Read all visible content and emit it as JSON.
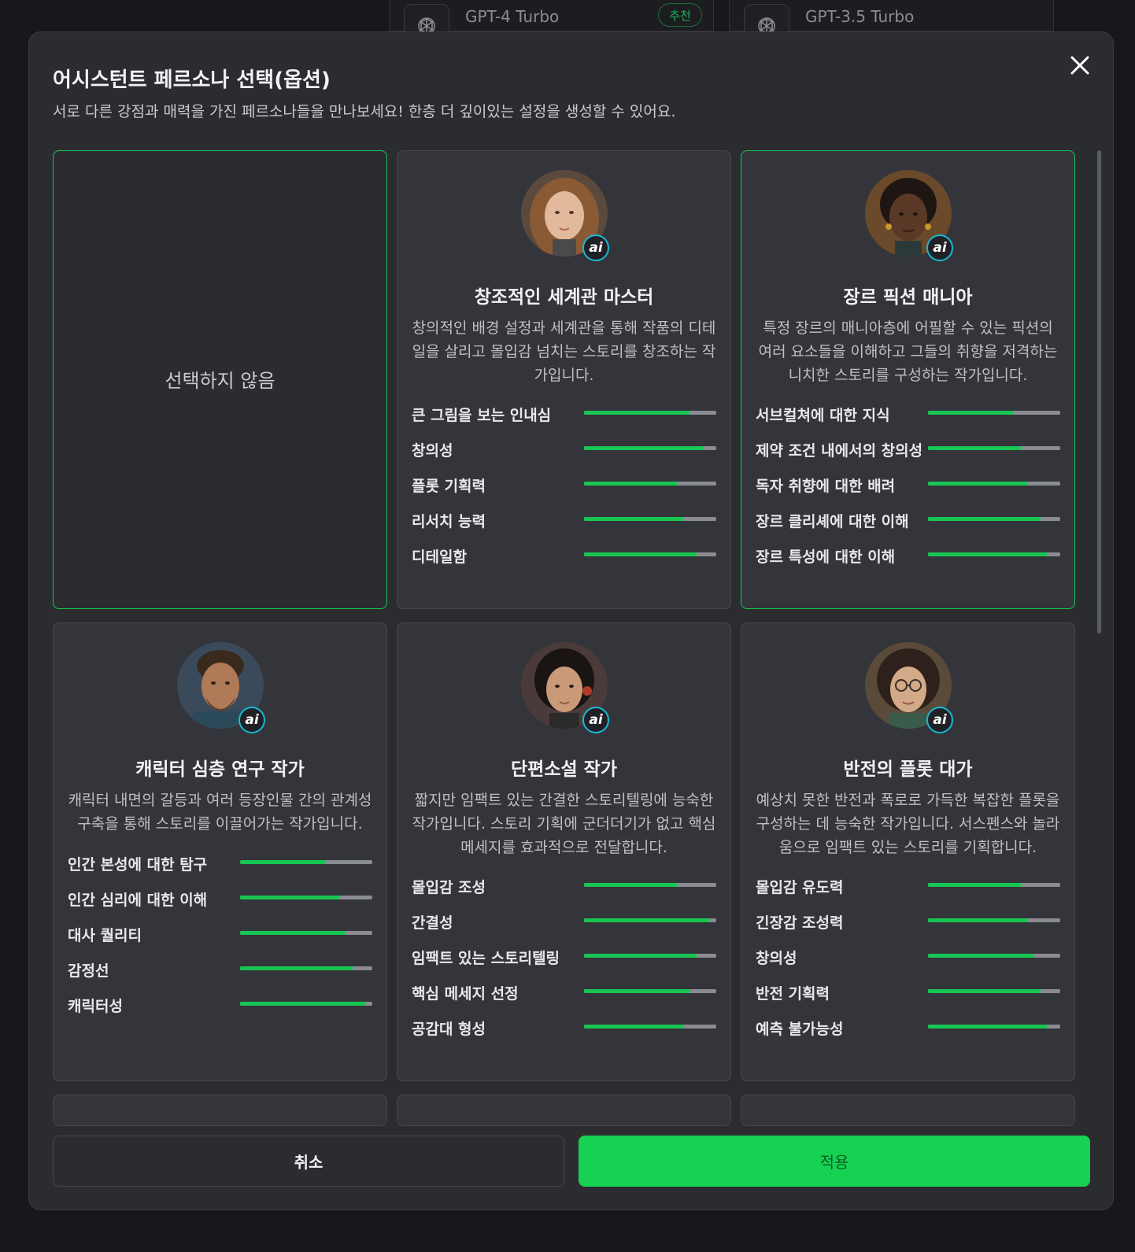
{
  "background_models": [
    {
      "name": "GPT-4 Turbo",
      "badge": "추천"
    },
    {
      "name": "GPT-3.5 Turbo"
    }
  ],
  "modal": {
    "title": "어시스턴트 페르소나 선택(옵션)",
    "subtitle": "서로 다른 강점과 매력을 가진 페르소나들을 만나보세요! 한층 더 깊이있는 설정을 생성할 수 있어요.",
    "close_icon": "close-icon"
  },
  "none_option": {
    "label": "선택하지 않음",
    "selected": true
  },
  "ai_badge": "ai",
  "personas": [
    {
      "name": "창조적인 세계관 마스터",
      "description": "창의적인 배경 설정과 세계관을 통해 작품의 디테일을 살리고 몰입감 넘치는 스토리를 창조하는 작가입니다.",
      "selected": false,
      "stats": [
        {
          "label": "큰 그림을 보는 인내심",
          "value": 0.8
        },
        {
          "label": "창의성",
          "value": 0.9
        },
        {
          "label": "플롯 기획력",
          "value": 0.7
        },
        {
          "label": "리서치 능력",
          "value": 0.75
        },
        {
          "label": "디테일함",
          "value": 0.85
        }
      ]
    },
    {
      "name": "장르 픽션 매니아",
      "description": "특정 장르의 매니아층에 어필할 수 있는 픽션의 여러 요소들을 이해하고 그들의 취향을 저격하는 니치한 스토리를 구성하는 작가입니다.",
      "selected": true,
      "stats": [
        {
          "label": "서브컬쳐에 대한 지식",
          "value": 0.65
        },
        {
          "label": "제약 조건 내에서의 창의성",
          "value": 0.7
        },
        {
          "label": "독자 취향에 대한 배려",
          "value": 0.75
        },
        {
          "label": "장르 클리셰에 대한 이해",
          "value": 0.85
        },
        {
          "label": "장르 특성에 대한 이해",
          "value": 0.9
        }
      ]
    },
    {
      "name": "캐릭터 심층 연구 작가",
      "description": "캐릭터 내면의 갈등과 여러 등장인물 간의 관계성 구축을 통해 스토리를 이끌어가는 작가입니다.",
      "selected": false,
      "stats": [
        {
          "label": "인간 본성에 대한 탐구",
          "value": 0.65
        },
        {
          "label": "인간 심리에 대한 이해",
          "value": 0.75
        },
        {
          "label": "대사 퀄리티",
          "value": 0.8
        },
        {
          "label": "감정선",
          "value": 0.85
        },
        {
          "label": "캐릭터성",
          "value": 0.95
        }
      ]
    },
    {
      "name": "단편소설 작가",
      "description": "짧지만 임팩트 있는 간결한 스토리텔링에 능숙한 작가입니다. 스토리 기획에 군더더기가 없고 핵심 메세지를 효과적으로 전달합니다.",
      "selected": false,
      "stats": [
        {
          "label": "몰입감 조성",
          "value": 0.7
        },
        {
          "label": "간결성",
          "value": 0.95
        },
        {
          "label": "임팩트 있는 스토리텔링",
          "value": 0.85
        },
        {
          "label": "핵심 메세지 선정",
          "value": 0.8
        },
        {
          "label": "공감대 형성",
          "value": 0.75
        }
      ]
    },
    {
      "name": "반전의 플롯 대가",
      "description": "예상치 못한 반전과 폭로로 가득한 복잡한 플롯을 구성하는 데 능숙한 작가입니다. 서스펜스와 놀라움으로 임팩트 있는 스토리를 기획합니다.",
      "selected": false,
      "stats": [
        {
          "label": "몰입감 유도력",
          "value": 0.7
        },
        {
          "label": "긴장감 조성력",
          "value": 0.75
        },
        {
          "label": "창의성",
          "value": 0.8
        },
        {
          "label": "반전 기획력",
          "value": 0.85
        },
        {
          "label": "예측 불가능성",
          "value": 0.9
        }
      ]
    }
  ],
  "footer": {
    "cancel_label": "취소",
    "apply_label": "적용"
  },
  "colors": {
    "accent": "#17c653",
    "apply_button": "#17d152",
    "ai_ring": "#19b8d8"
  }
}
